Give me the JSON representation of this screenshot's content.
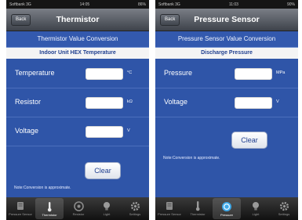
{
  "left": {
    "status": {
      "carrier": "Softbank 3G",
      "time": "14:05",
      "battery": "86%"
    },
    "nav": {
      "back": "Back",
      "title": "Thermistor"
    },
    "subtitle": "Thermistor Value Conversion",
    "section": "Indoor Unit HEX Temperature",
    "rows": [
      {
        "label": "Temperature",
        "value": "",
        "unit": "°C"
      },
      {
        "label": "Resistor",
        "value": "",
        "unit": "kΩ"
      },
      {
        "label": "Voltage",
        "value": "",
        "unit": "V"
      }
    ],
    "clear": "Clear",
    "note": "Note:Conversion is approximate.",
    "tabs": [
      {
        "label": "Pressure Sensor",
        "icon": "pressure-gauge-icon",
        "selected": false
      },
      {
        "label": "Thermistor",
        "icon": "thermometer-icon",
        "selected": true
      },
      {
        "label": "Resistor",
        "icon": "resistor-icon",
        "selected": false
      },
      {
        "label": "Light",
        "icon": "bulb-icon",
        "selected": false
      },
      {
        "label": "Settings",
        "icon": "gear-icon",
        "selected": false
      }
    ]
  },
  "right": {
    "status": {
      "carrier": "Softbank 3G",
      "time": "11:03",
      "battery": "90%"
    },
    "nav": {
      "back": "Back",
      "title": "Pressure Sensor"
    },
    "subtitle": "Pressure Sensor Value Conversion",
    "section": "Discharge Pressure",
    "rows": [
      {
        "label": "Pressure",
        "value": "",
        "unit": "MPa"
      },
      {
        "label": "Voltage",
        "value": "",
        "unit": "V"
      }
    ],
    "clear": "Clear",
    "note": "Note:Conversion is approximate.",
    "tabs": [
      {
        "label": "Pressure Sensor",
        "icon": "pressure-gauge-icon",
        "selected": false
      },
      {
        "label": "Thermistor",
        "icon": "thermometer-icon",
        "selected": false
      },
      {
        "label": "Pressure",
        "icon": "dial-icon",
        "selected": true
      },
      {
        "label": "Light",
        "icon": "bulb-icon",
        "selected": false
      },
      {
        "label": "Settings",
        "icon": "gear-icon",
        "selected": false
      }
    ]
  }
}
